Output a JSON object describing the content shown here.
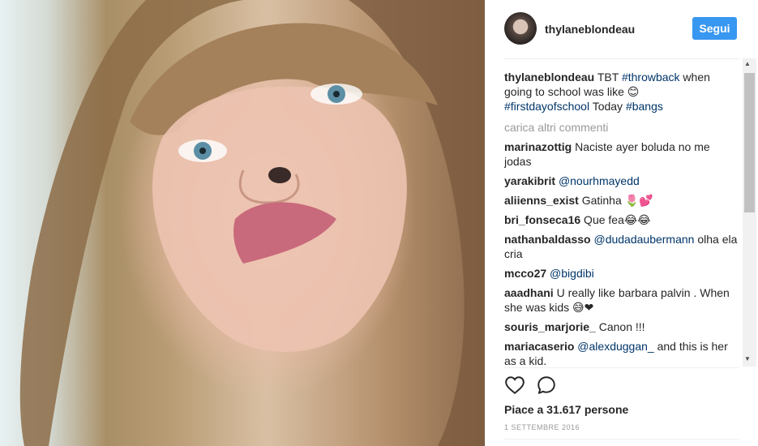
{
  "post": {
    "username": "thylaneblondeau",
    "follow_label": "Segui",
    "caption": {
      "user": "thylaneblondeau",
      "t1": " TBT ",
      "tag1": "#throwback",
      "t2": " when going to school was like 😊",
      "tag2": "#firstdayofschool",
      "t3": " Today ",
      "tag3": "#bangs"
    },
    "load_more": "carica altri commenti",
    "comments": [
      {
        "user": "marinazottig",
        "text": " Naciste ayer boluda no me jodas"
      },
      {
        "user": "yarakibrit",
        "mention": "@nourhmayedd",
        "text": ""
      },
      {
        "user": "aliienns_exist",
        "text": " Gatinha 🌷💕"
      },
      {
        "user": "bri_fonseca16",
        "text": " Que fea😂😂"
      },
      {
        "user": "nathanbaldasso",
        "mention": "@dudadaubermann",
        "text": " olha ela cria"
      },
      {
        "user": "mcco27",
        "mention": "@bigdibi",
        "text": ""
      },
      {
        "user": "aaadhani",
        "text": " U really like barbara palvin . When she was kids 😅❤"
      },
      {
        "user": "souris_marjorie_",
        "text": " Canon !!!"
      },
      {
        "user": "mariacaserio",
        "mention": "@alexduggan_",
        "text": " and this is her as a kid."
      }
    ],
    "likes": "Piace a 31.617 persone",
    "date": "1 SETTEMBRE 2016"
  },
  "icons": {
    "heart": "heart-icon",
    "comment": "comment-icon"
  },
  "colors": {
    "follow_button": "#3897f0",
    "hashtag": "#003569",
    "muted": "#999999"
  }
}
